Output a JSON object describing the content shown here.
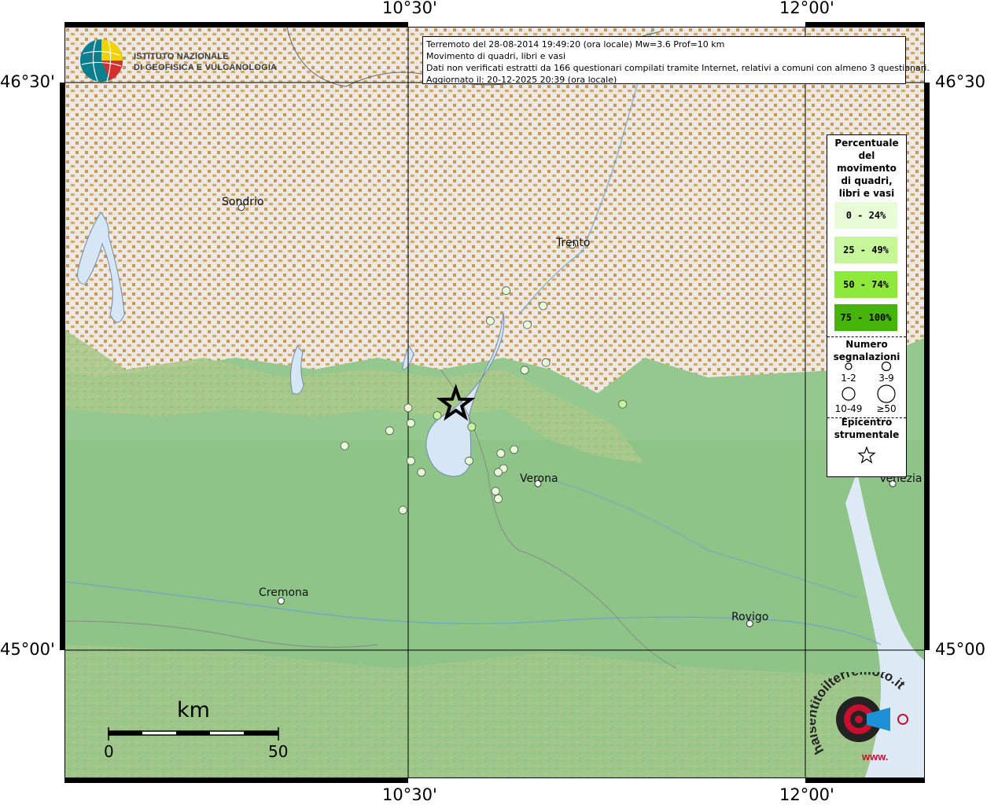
{
  "header": {
    "line1": "Terremoto del 28-08-2014 19:49:20 (ora locale) Mw=3.6 Prof=10 km",
    "line2": "Movimento di quadri, libri e vasi",
    "line3": "Dati non verificati estratti da 166 questionari compilati tramite Internet, relativi a comuni con almeno 3 questionari.",
    "line4": "Aggiornato il: 20-12-2025 20:39 (ora locale)"
  },
  "logos": {
    "ingv_line1": "ISTITUTO NAZIONALE",
    "ingv_line2": "DI GEOFISICA E VULCANOLOGIA",
    "hsit_text": "haisentitoilterremoto.it",
    "hsit_www": "www."
  },
  "axes": {
    "lon_ticks": [
      "10°30'",
      "12°00'"
    ],
    "lat_ticks": [
      "46°30'",
      "45°00'"
    ]
  },
  "cities": [
    {
      "name": "Sondrio",
      "lon": 9.87,
      "lat": 46.17
    },
    {
      "name": "Trento",
      "lon": 11.12,
      "lat": 46.07
    },
    {
      "name": "Verona",
      "lon": 10.99,
      "lat": 45.44
    },
    {
      "name": "Cremona",
      "lon": 10.02,
      "lat": 45.13
    },
    {
      "name": "Rovigo",
      "lon": 11.79,
      "lat": 45.07
    },
    {
      "name": "Venezia",
      "lon": 12.33,
      "lat": 45.44
    }
  ],
  "legend": {
    "title_lines": [
      "Percentuale",
      "del",
      "movimento",
      "di quadri,",
      "libri e vasi"
    ],
    "classes": [
      {
        "label": "0 - 24%",
        "color": "#e8fcd8"
      },
      {
        "label": "25 - 49%",
        "color": "#c6f59a"
      },
      {
        "label": "50 - 74%",
        "color": "#8fe83c"
      },
      {
        "label": "75 - 100%",
        "color": "#46b40a"
      }
    ],
    "count_title_lines": [
      "Numero",
      "segnalazioni"
    ],
    "count_classes": [
      "1-2",
      "3-9",
      "10-49",
      "≥50"
    ],
    "epicenter_title_lines": [
      "Epicentro",
      "strumentale"
    ]
  },
  "scale_bar": {
    "unit": "km",
    "start": "0",
    "end": "50"
  },
  "chart_data": {
    "type": "scatter",
    "projection": "lon/lat",
    "lon_range": [
      9.2,
      12.45
    ],
    "lat_range": [
      44.7,
      46.65
    ],
    "epicenter": {
      "lon": 10.68,
      "lat": 45.65
    },
    "points": [
      {
        "lon": 10.87,
        "lat": 45.95,
        "class": 0
      },
      {
        "lon": 10.81,
        "lat": 45.87,
        "class": 0
      },
      {
        "lon": 10.95,
        "lat": 45.86,
        "class": 0
      },
      {
        "lon": 11.01,
        "lat": 45.91,
        "class": 0
      },
      {
        "lon": 11.02,
        "lat": 45.76,
        "class": 0
      },
      {
        "lon": 10.94,
        "lat": 45.74,
        "class": 0
      },
      {
        "lon": 10.5,
        "lat": 45.64,
        "class": 0
      },
      {
        "lon": 10.51,
        "lat": 45.6,
        "class": 0
      },
      {
        "lon": 10.43,
        "lat": 45.58,
        "class": 0
      },
      {
        "lon": 10.61,
        "lat": 45.62,
        "class": 1
      },
      {
        "lon": 10.74,
        "lat": 45.59,
        "class": 1
      },
      {
        "lon": 10.26,
        "lat": 45.54,
        "class": 0
      },
      {
        "lon": 10.9,
        "lat": 45.53,
        "class": 0
      },
      {
        "lon": 10.85,
        "lat": 45.52,
        "class": 0
      },
      {
        "lon": 10.51,
        "lat": 45.5,
        "class": 0
      },
      {
        "lon": 10.55,
        "lat": 45.47,
        "class": 0
      },
      {
        "lon": 10.73,
        "lat": 45.5,
        "class": 0
      },
      {
        "lon": 10.86,
        "lat": 45.48,
        "class": 0
      },
      {
        "lon": 10.84,
        "lat": 45.47,
        "class": 0
      },
      {
        "lon": 10.83,
        "lat": 45.42,
        "class": 0
      },
      {
        "lon": 10.84,
        "lat": 45.4,
        "class": 0
      },
      {
        "lon": 10.48,
        "lat": 45.37,
        "class": 0
      },
      {
        "lon": 11.31,
        "lat": 45.65,
        "class": 1
      }
    ]
  }
}
